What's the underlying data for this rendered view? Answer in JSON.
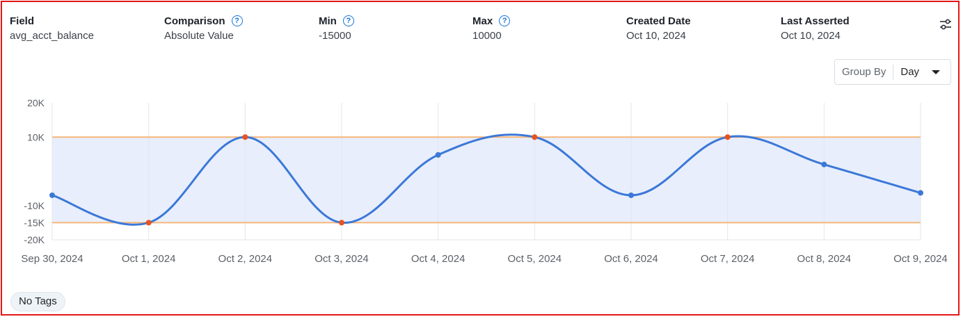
{
  "fields": [
    {
      "label": "Field",
      "value": "avg_acct_balance",
      "help": false
    },
    {
      "label": "Comparison",
      "value": "Absolute Value",
      "help": true
    },
    {
      "label": "Min",
      "value": "-15000",
      "help": true
    },
    {
      "label": "Max",
      "value": "10000",
      "help": true
    },
    {
      "label": "Created Date",
      "value": "Oct 10, 2024",
      "help": false
    },
    {
      "label": "Last Asserted",
      "value": "Oct 10, 2024",
      "help": false
    }
  ],
  "help_glyph": "?",
  "group_by": {
    "label": "Group By",
    "value": "Day"
  },
  "tags_label": "No Tags",
  "colors": {
    "line": "#3b78d8",
    "band": "#e8eefb",
    "bound": "#f6b67b",
    "violation": "#e8531f"
  },
  "chart_data": {
    "type": "line",
    "x": [
      "Sep 30, 2024",
      "Oct 1, 2024",
      "Oct 2, 2024",
      "Oct 3, 2024",
      "Oct 4, 2024",
      "Oct 5, 2024",
      "Oct 6, 2024",
      "Oct 7, 2024",
      "Oct 8, 2024",
      "Oct 9, 2024"
    ],
    "series": [
      {
        "values": [
          -7000,
          -15000,
          10000,
          -15000,
          4800,
          10000,
          -7000,
          10000,
          2000,
          -6300
        ]
      }
    ],
    "violations": [
      false,
      true,
      true,
      true,
      false,
      true,
      false,
      true,
      false,
      false
    ],
    "bounds": {
      "min": -15000,
      "max": 10000
    },
    "yticks": [
      {
        "value": 20000,
        "label": "20K"
      },
      {
        "value": 10000,
        "label": "10K"
      },
      {
        "value": -10000,
        "label": "-10K"
      },
      {
        "value": -15000,
        "label": "-15K"
      },
      {
        "value": -20000,
        "label": "-20K"
      }
    ],
    "ylim": [
      -20000,
      20000
    ],
    "xlabel": "",
    "ylabel": ""
  }
}
